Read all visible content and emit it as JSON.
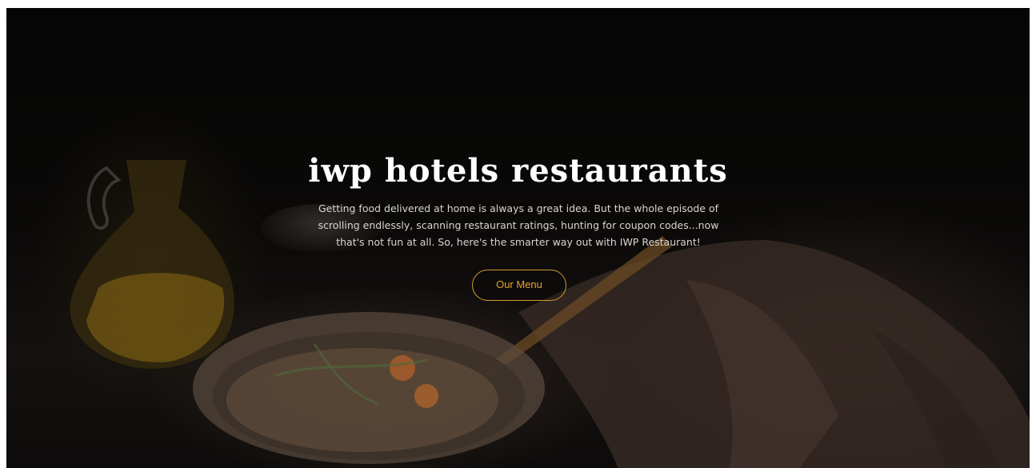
{
  "hero": {
    "title": "iwp hotels restaurants",
    "description": "Getting food delivered at home is always a great idea. But the whole episode of scrolling endlessly, scanning restaurant ratings, hunting for coupon codes...now that's not fun at all. So, here's the smarter way out with IWP Restaurant!",
    "cta_label": "Our Menu"
  },
  "colors": {
    "accent": "#d49a2b",
    "title_text": "#ffffff",
    "body_text": "#d9d6d2",
    "background": "#0a0908"
  }
}
